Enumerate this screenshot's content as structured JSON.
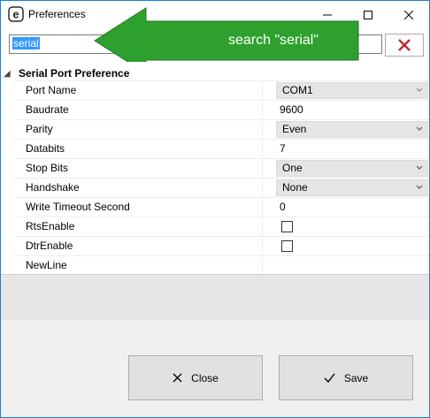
{
  "window": {
    "title": "Preferences"
  },
  "search": {
    "value": "serial"
  },
  "annotation": {
    "text": "search \"serial\"",
    "color": "#2ea02e"
  },
  "category": {
    "label": "Serial Port Preference"
  },
  "properties": [
    {
      "name": "Port Name",
      "value": "COM1",
      "kind": "combo"
    },
    {
      "name": "Baudrate",
      "value": "9600",
      "kind": "text"
    },
    {
      "name": "Parity",
      "value": "Even",
      "kind": "combo"
    },
    {
      "name": "Databits",
      "value": "7",
      "kind": "text"
    },
    {
      "name": "Stop Bits",
      "value": "One",
      "kind": "combo"
    },
    {
      "name": "Handshake",
      "value": "None",
      "kind": "combo"
    },
    {
      "name": "Write Timeout Second",
      "value": "0",
      "kind": "text"
    },
    {
      "name": "RtsEnable",
      "value": "",
      "kind": "checkbox"
    },
    {
      "name": "DtrEnable",
      "value": "",
      "kind": "checkbox"
    },
    {
      "name": "NewLine",
      "value": "",
      "kind": "text"
    }
  ],
  "buttons": {
    "close": "Close",
    "save": "Save"
  },
  "colors": {
    "accent": "#1883d7",
    "selection": "#3399ff",
    "clear_x": "#c0272d"
  }
}
